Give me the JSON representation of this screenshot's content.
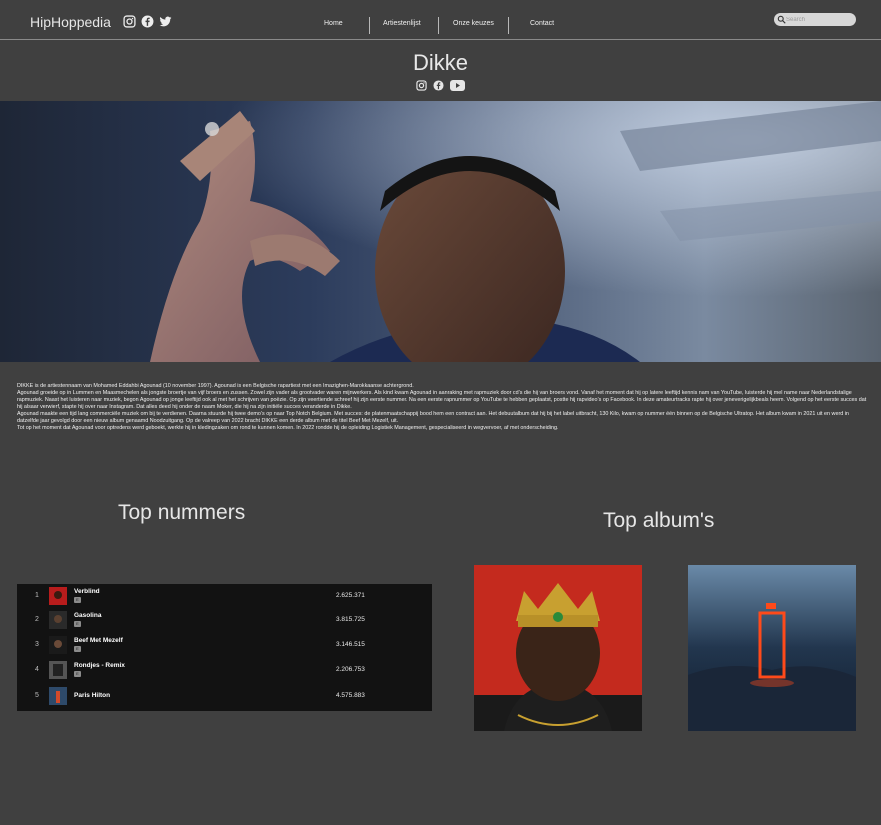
{
  "header": {
    "brand": "HipHoppedia",
    "brand_icons": [
      "instagram-icon",
      "facebook-icon",
      "twitter-icon"
    ],
    "nav": [
      "Home",
      "Artiestenlijst",
      "Onze keuzes",
      "Contact"
    ],
    "search_placeholder": "Search"
  },
  "artist": {
    "name": "Dikke",
    "social_icons": [
      "instagram-icon",
      "facebook-icon",
      "youtube-icon"
    ]
  },
  "bio": [
    "DIKKE is de artiestennaam van Mohamed Eddahbi Agounad (10 november 1997). Agounad is een Belgische rapartiest met een Imazighen-Marokkaanse achtergrond.",
    "Agounad groeide op in Lummen en Maasmechelen als jongste broertje van vijf broers en zussen. Zowel zijn vader als grootvader waren mijnwerkers. Als kind kwam Agounad in aanraking met rapmuziek door cd’s die hij van broers vond. Vanaf het moment dat hij op latere leeftijd kennis nam van YouTube, luisterde hij mel name naar Nederlandstalige rapmuziek. Naast het luisteren naar muziek, begon Agounad op jonge leeftijd ook al met het schrijven van poëzie. Op zijn veertiende schreef hij zijn eerste nummer. Na een eerste rapnummer op YouTube te hebben geplaatst, postte hij rapvideo’s op Facebook. In deze amateurtracks rapte hij over jeneverigelijkbeals heem. Volgend op het eerste succes dat hij alsaar verwierf, stapte hij over naar Instagram. Dat alles deed hij onder de naam Moker, die hij na zijn initiële succes veranderde in Dikke.",
    "Agounad maakte een tijd lang commerciële muziek om bij te verdienen. Daarna stuurde hij twee demo’s op naar Top Notch Belgium. Met succes: de platenmaatschappij bood hem een contract aan. Het debuutalbum dat hij bij het label uitbracht, 130 Kilo, kwam op nummer één binnen op de Belgische Ultratop. Het album kwam in 2021 uit en werd in datzelfde jaar gevolgd door een nieuw album genaamd Noodzuitgang. Op de valreep van 2022 bracht DIKKE een derde album met de titel Beef Met Mezelf, uit.",
    "Tot op het moment dat Agounad voor optredens werd geboekt, werkte hij in kledingzaken om rond te kunnen komen. In 2022 rondde hij de opleiding Logistiek Management, gespecialiseerd in wegvervoer, af met onderscheiding."
  ],
  "top_tracks": {
    "title": "Top nummers",
    "tracks": [
      {
        "num": "1",
        "title": "Verblind",
        "explicit": "E",
        "plays": "2.625.371"
      },
      {
        "num": "2",
        "title": "Gasolina",
        "explicit": "E",
        "plays": "3.815.725"
      },
      {
        "num": "3",
        "title": "Beef Met Mezelf",
        "explicit": "E",
        "plays": "3.146.515"
      },
      {
        "num": "4",
        "title": "Rondjes - Remix",
        "explicit": "E",
        "plays": "2.206.753"
      },
      {
        "num": "5",
        "title": "Paris Hilton",
        "explicit": "",
        "plays": "4.575.883"
      }
    ]
  },
  "top_albums": {
    "title": "Top album's"
  },
  "colors": {
    "background": "#404040",
    "player_bg": "#121212",
    "search_bg": "#d7d7d7"
  }
}
